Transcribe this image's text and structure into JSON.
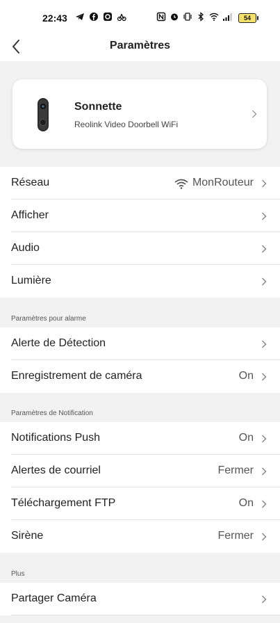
{
  "status_bar": {
    "time": "22:43",
    "battery": "54"
  },
  "header": {
    "title": "Paramètres"
  },
  "device": {
    "name": "Sonnette",
    "model": "Reolink Video Doorbell WiFi"
  },
  "group1": {
    "rows": [
      {
        "label": "Réseau",
        "value": "MonRouteur"
      },
      {
        "label": "Afficher",
        "value": ""
      },
      {
        "label": "Audio",
        "value": ""
      },
      {
        "label": "Lumière",
        "value": ""
      }
    ]
  },
  "alarm_section": {
    "title": "Paramètres pour alarme",
    "rows": [
      {
        "label": "Alerte de Détection",
        "value": ""
      },
      {
        "label": "Enregistrement de caméra",
        "value": "On"
      }
    ]
  },
  "notification_section": {
    "title": "Paramètres de Notification",
    "rows": [
      {
        "label": "Notifications Push",
        "value": "On"
      },
      {
        "label": "Alertes de courriel",
        "value": "Fermer"
      },
      {
        "label": "Téléchargement FTP",
        "value": "On"
      },
      {
        "label": "Sirène",
        "value": "Fermer"
      }
    ]
  },
  "more_section": {
    "title": "Plus",
    "rows": [
      {
        "label": "Partager Caméra",
        "value": ""
      }
    ]
  },
  "colors": {
    "background": "#f2f2f2",
    "card": "#ffffff",
    "text": "#222222",
    "secondary_text": "#555555",
    "separator": "#e3e3e3"
  }
}
